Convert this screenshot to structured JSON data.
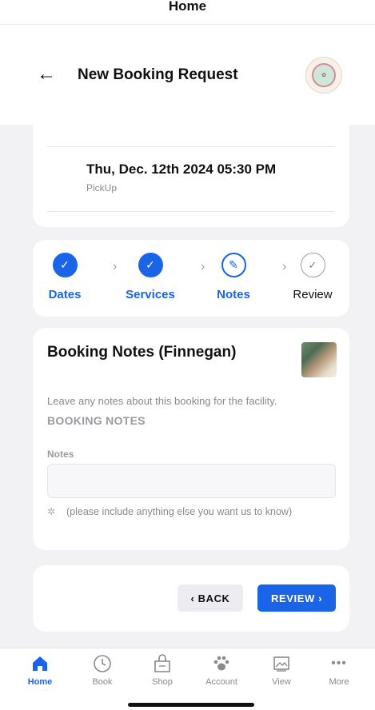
{
  "top_bar": {
    "title": "Home"
  },
  "header": {
    "back_icon": "arrow-left-icon",
    "title": "New Booking Request",
    "logo": "facility-logo"
  },
  "pickup": {
    "datetime": "Thu, Dec. 12th 2024  05:30 PM",
    "label": "PickUp"
  },
  "stepper": {
    "steps": [
      {
        "label": "Dates",
        "state": "done"
      },
      {
        "label": "Services",
        "state": "done"
      },
      {
        "label": "Notes",
        "state": "current"
      },
      {
        "label": "Review",
        "state": "pending"
      }
    ],
    "accent": "#1a64e8"
  },
  "notes": {
    "title": "Booking Notes (Finnegan)",
    "description": "Leave any notes about this booking for the facility.",
    "section": "BOOKING NOTES",
    "field_label": "Notes",
    "field_value": "",
    "hint": "(please include anything else you want us to know)",
    "hint_icon": "lightbulb-icon"
  },
  "actions": {
    "back_label": "‹  BACK",
    "review_label": "REVIEW  ›"
  },
  "tabbar": {
    "items": [
      {
        "label": "Home",
        "icon": "home-icon",
        "active": true
      },
      {
        "label": "Book",
        "icon": "clock-icon",
        "active": false
      },
      {
        "label": "Shop",
        "icon": "shop-icon",
        "active": false
      },
      {
        "label": "Account",
        "icon": "paw-icon",
        "active": false
      },
      {
        "label": "View",
        "icon": "gallery-icon",
        "active": false
      },
      {
        "label": "More",
        "icon": "more-icon",
        "active": false
      }
    ]
  }
}
